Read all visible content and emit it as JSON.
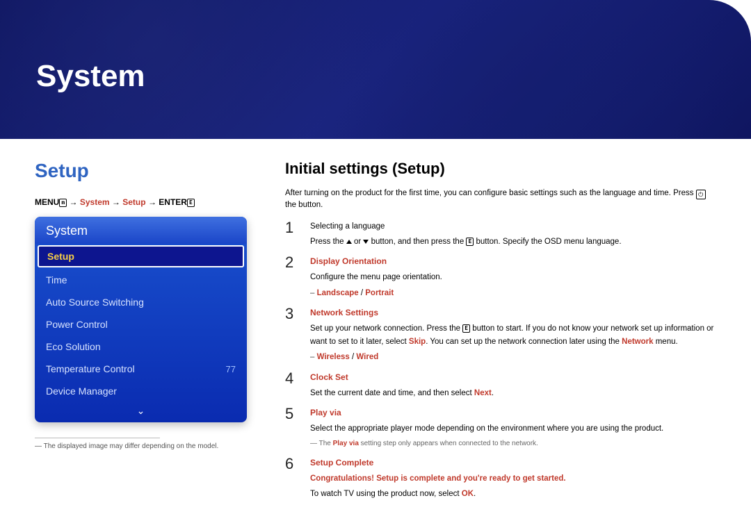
{
  "banner": {
    "title": "System"
  },
  "left": {
    "section_title": "Setup",
    "breadcrumb": {
      "menu": "MENU",
      "menu_icon": "m",
      "arrow": " → ",
      "p1": "System",
      "p2": "Setup",
      "enter": "ENTER",
      "enter_icon": "E"
    },
    "osd": {
      "header": "System",
      "items": [
        {
          "label": "Setup",
          "value": "",
          "selected": true
        },
        {
          "label": "Time",
          "value": ""
        },
        {
          "label": "Auto Source Switching",
          "value": ""
        },
        {
          "label": "Power Control",
          "value": ""
        },
        {
          "label": "Eco Solution",
          "value": ""
        },
        {
          "label": "Temperature Control",
          "value": "77"
        },
        {
          "label": "Device Manager",
          "value": ""
        }
      ],
      "down_glyph": "⌄"
    },
    "footnote": "The displayed image may differ depending on the model."
  },
  "right": {
    "title": "Initial settings (Setup)",
    "intro_a": "After turning on the product for the first time, you can configure basic settings such as the language and time. Press ",
    "intro_icon": "⏻",
    "intro_b": " the button.",
    "steps": [
      {
        "num": "1",
        "plain_heading": "Selecting a language",
        "body_a": "Press the ",
        "body_b": " or ",
        "body_c": " button, and then press the ",
        "body_enter_icon": "E",
        "body_d": " button. Specify the OSD menu language."
      },
      {
        "num": "2",
        "red_heading": "Display Orientation",
        "body": "Configure the menu page orientation.",
        "sub_red_a": "Landscape",
        "sub_sep": " / ",
        "sub_red_b": "Portrait"
      },
      {
        "num": "3",
        "red_heading": "Network Settings",
        "body_a": "Set up your network connection. Press the ",
        "body_enter_icon": "E",
        "body_b": " button to start. If you do not know your network set up information or want to set to it later, select ",
        "skip": "Skip",
        "body_c": ". You can set up the network connection later using the ",
        "network": "Network",
        "body_d": " menu.",
        "sub_red_a": "Wireless",
        "sub_sep": " / ",
        "sub_red_b": "Wired"
      },
      {
        "num": "4",
        "red_heading": "Clock Set",
        "body_a": "Set the current date and time, and then select ",
        "next": "Next",
        "body_b": "."
      },
      {
        "num": "5",
        "red_heading": "Play via",
        "body": "Select the appropriate player mode depending on the environment where you are using the product.",
        "note_a": "The ",
        "note_playvia": "Play via",
        "note_b": " setting step only appears when connected to the network."
      },
      {
        "num": "6",
        "red_heading": "Setup Complete",
        "congrats": "Congratulations! Setup is complete and you're ready to get started.",
        "body_a": "To watch TV using the product now, select ",
        "ok": "OK",
        "body_b": "."
      }
    ]
  }
}
